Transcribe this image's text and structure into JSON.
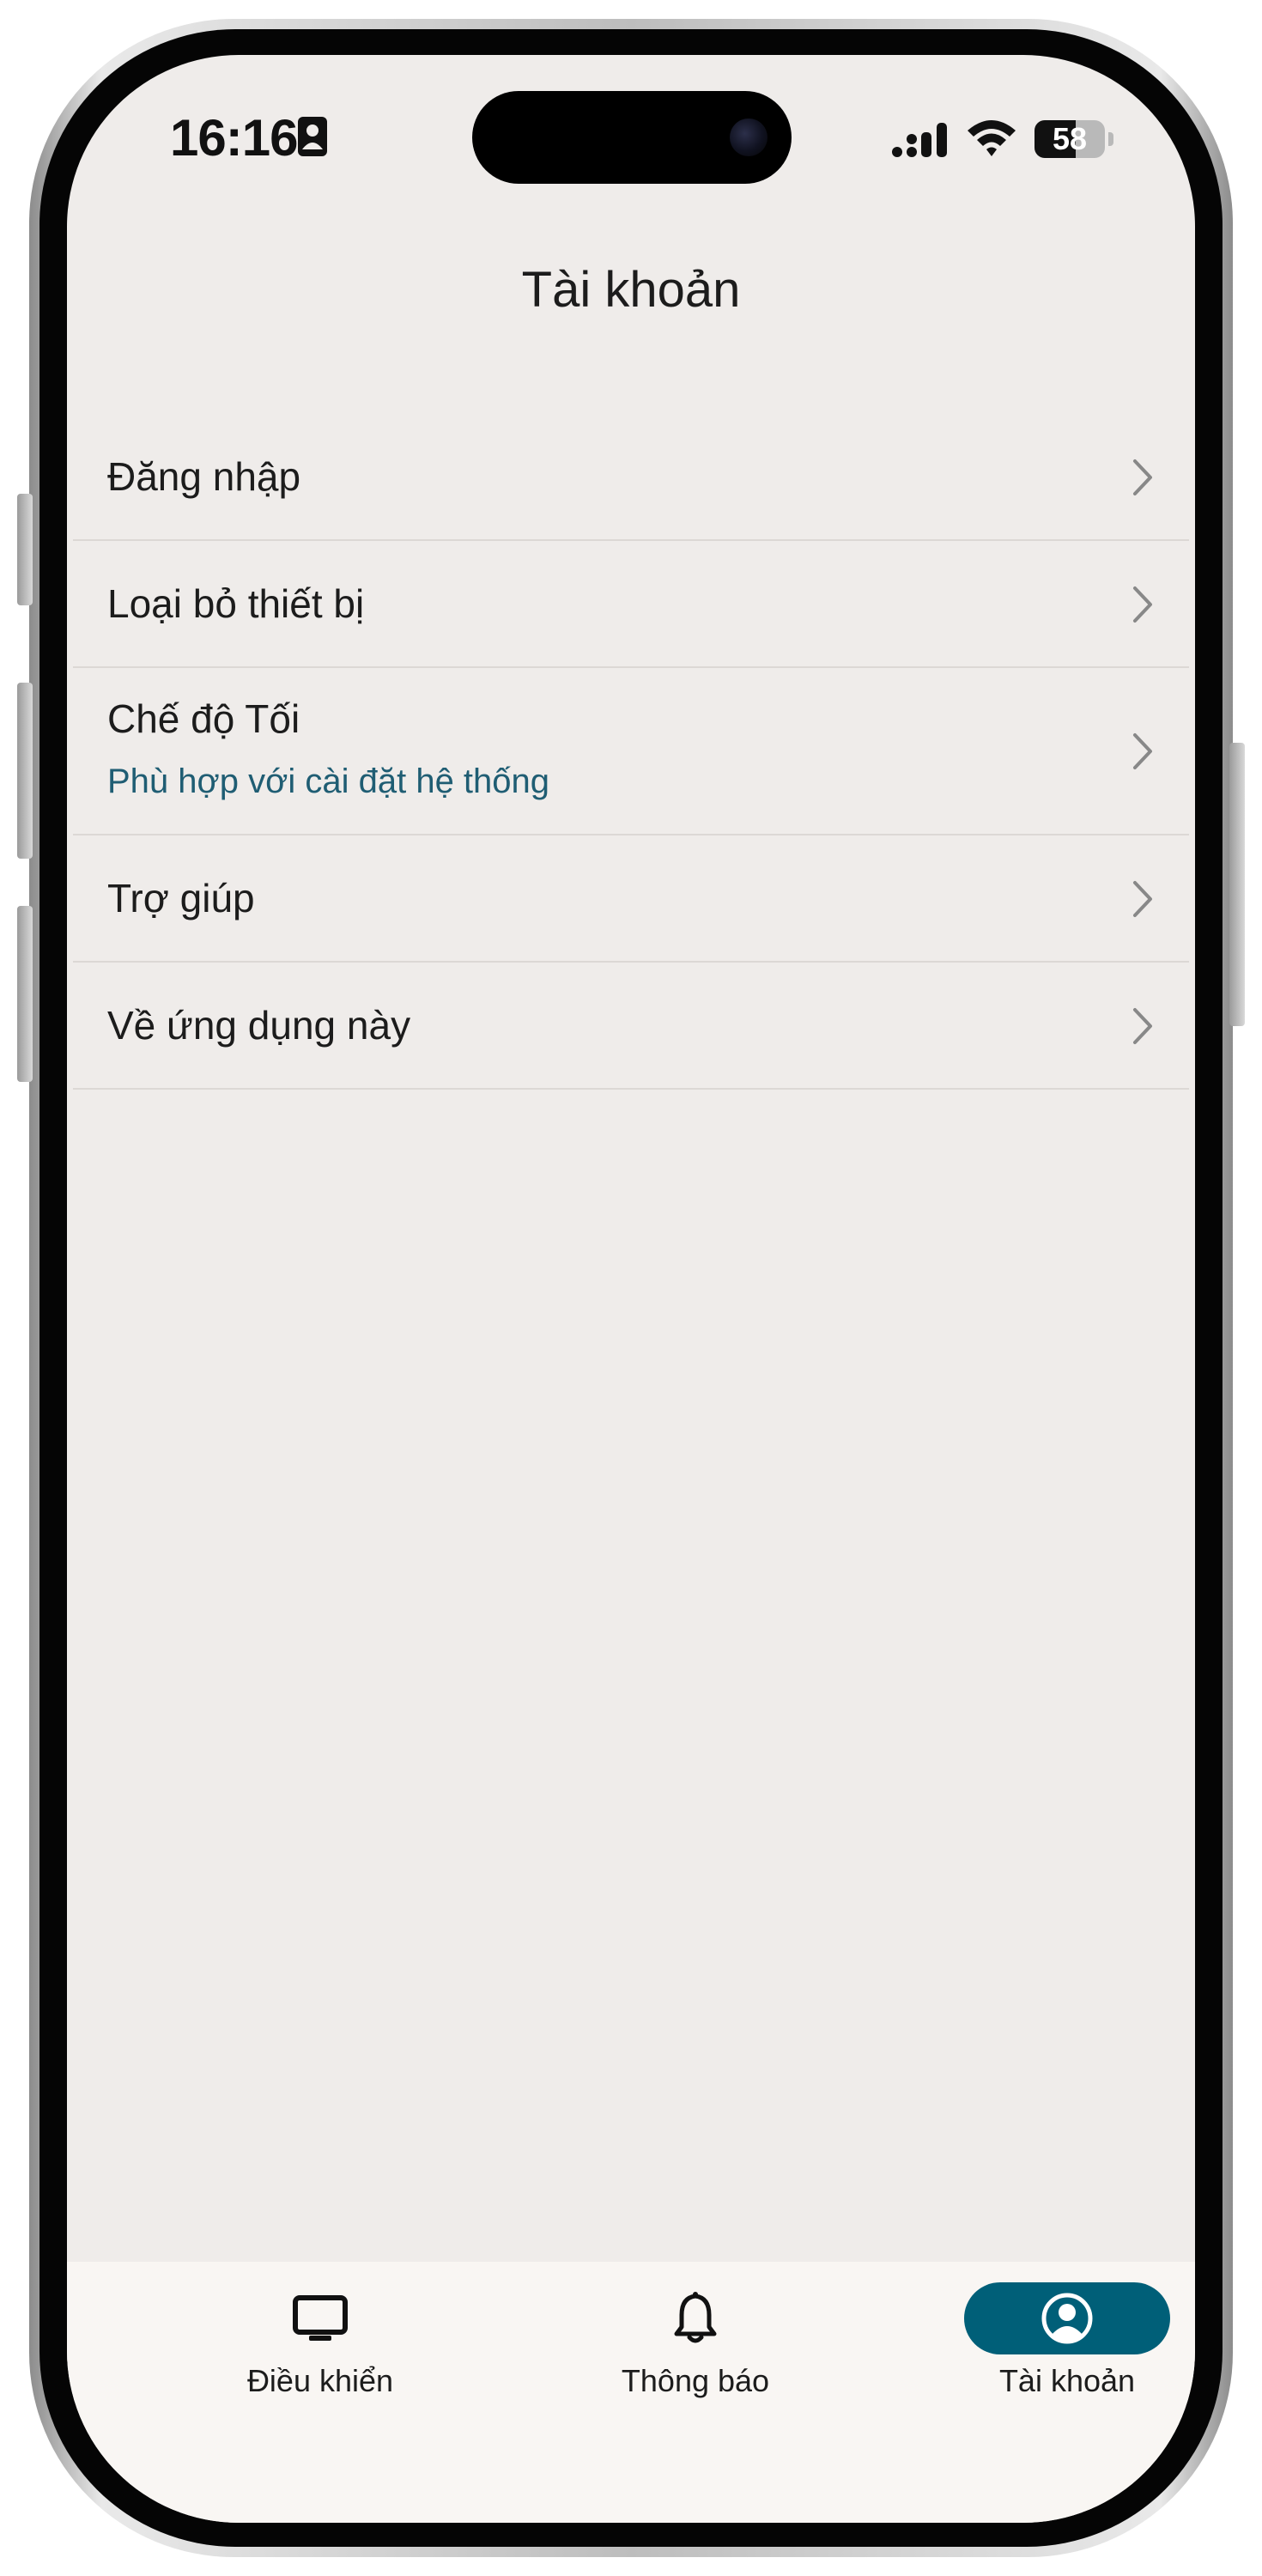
{
  "status_bar": {
    "time": "16:16",
    "battery_percent": "58",
    "battery_level": 0.58,
    "icons": [
      "id-card-icon",
      "signal-icon",
      "wifi-icon",
      "battery-icon"
    ]
  },
  "header": {
    "title": "Tài khoản"
  },
  "settings": {
    "items": [
      {
        "label": "Đăng nhập",
        "sublabel": "",
        "icon": "chevron-right-icon"
      },
      {
        "label": "Loại bỏ thiết bị",
        "sublabel": "",
        "icon": "chevron-right-icon"
      },
      {
        "label": "Chế độ Tối",
        "sublabel": "Phù hợp với cài đặt hệ thống",
        "icon": "chevron-right-icon"
      },
      {
        "label": "Trợ giúp",
        "sublabel": "",
        "icon": "chevron-right-icon"
      },
      {
        "label": "Về ứng dụng này",
        "sublabel": "",
        "icon": "chevron-right-icon"
      }
    ]
  },
  "tab_bar": {
    "tabs": [
      {
        "label": "Điều khiển",
        "icon": "tv-icon",
        "active": false
      },
      {
        "label": "Thông báo",
        "icon": "bell-icon",
        "active": false
      },
      {
        "label": "Tài khoản",
        "icon": "account-icon",
        "active": true
      }
    ]
  },
  "colors": {
    "accent": "#005f78",
    "sublabel": "#1f5d73",
    "background": "#efecea",
    "tab_bar_background": "#f9f6f3",
    "divider": "#dcd8d5"
  }
}
